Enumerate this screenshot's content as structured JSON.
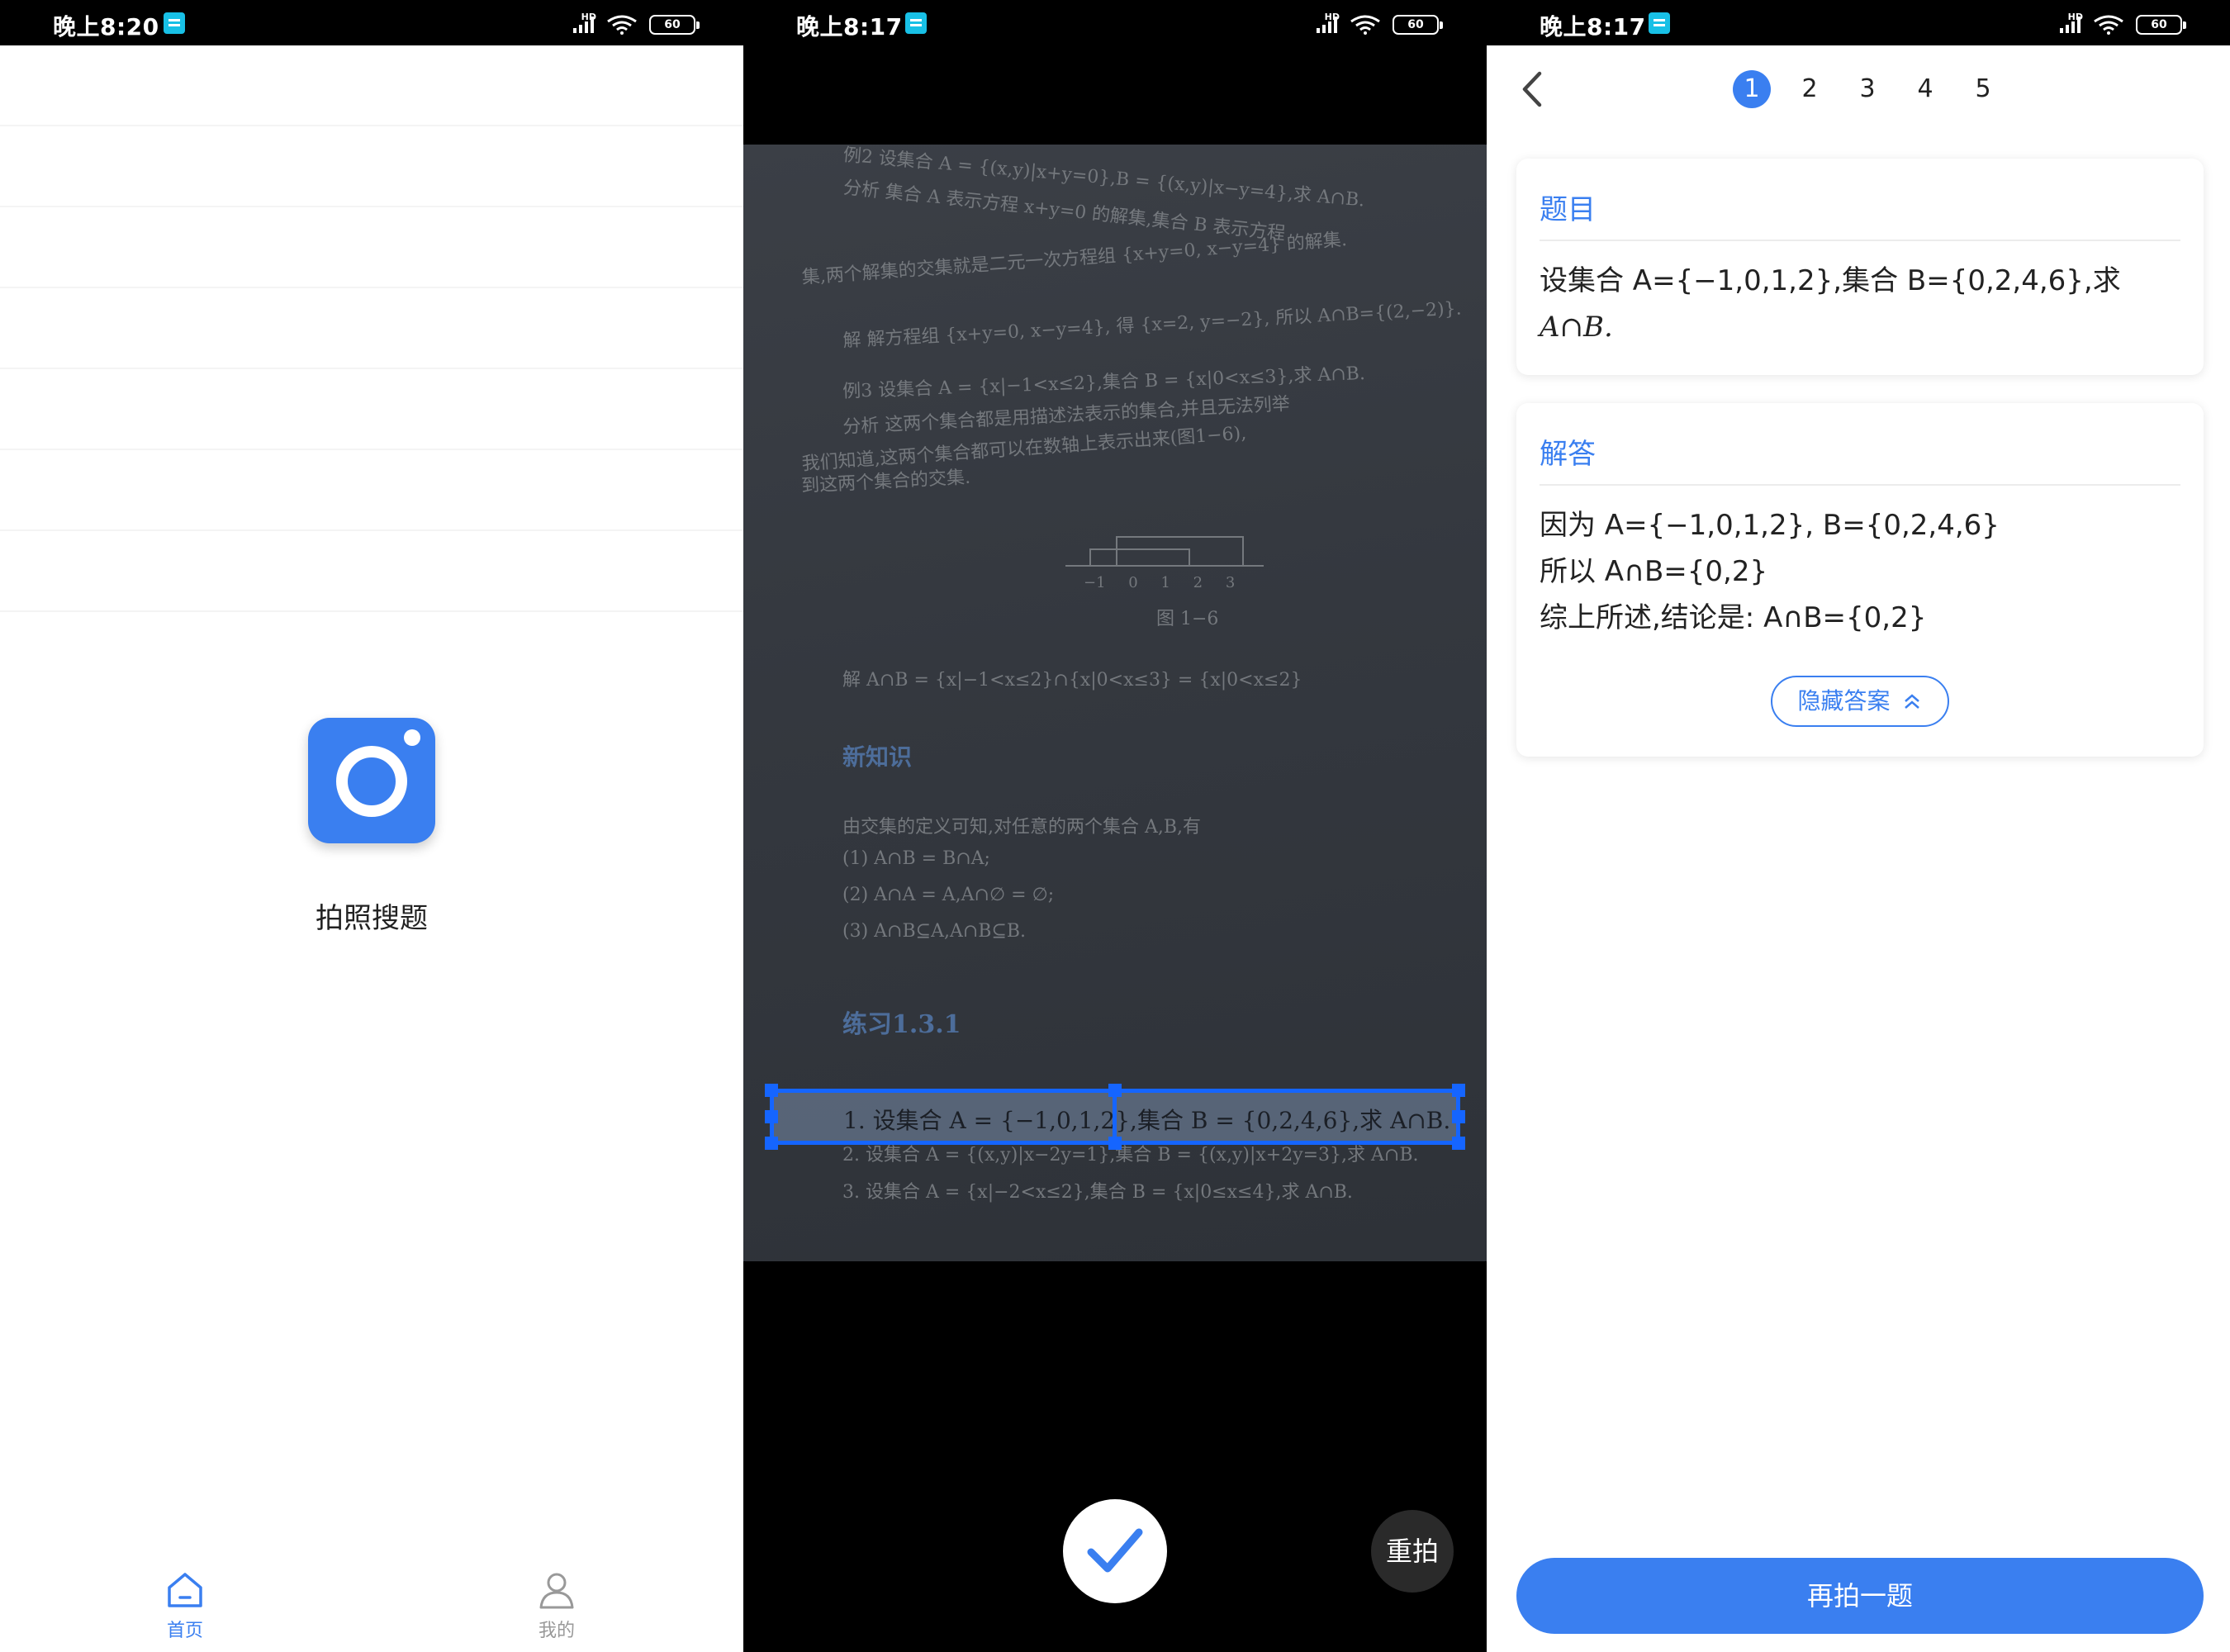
{
  "status_bars": [
    {
      "time": "晚上8:20",
      "battery": "60",
      "hd": "HD"
    },
    {
      "time": "晚上8:17",
      "battery": "60",
      "hd": "HD"
    },
    {
      "time": "晚上8:17",
      "battery": "60",
      "hd": "HD"
    }
  ],
  "home": {
    "camera_label": "拍照搜题",
    "tabs": [
      {
        "label": "首页",
        "icon": "home-icon",
        "active": true
      },
      {
        "label": "我的",
        "icon": "user-icon",
        "active": false
      }
    ]
  },
  "capture": {
    "page_lines": [
      "例2  设集合 A = {(x,y)|x+y=0},B = {(x,y)|x−y=4},求 A∩B.",
      "分析  集合 A 表示方程 x+y=0 的解集,集合 B 表示方程",
      "集,两个解集的交集就是二元一次方程组 {x+y=0, x−y=4} 的解集.",
      "解  解方程组 {x+y=0, x−y=4}, 得 {x=2, y=−2}, 所以 A∩B={(2,−2)}.",
      "例3  设集合 A = {x|−1<x≤2},集合 B = {x|0<x≤3},求 A∩B.",
      "分析  这两个集合都是用描述法表示的集合,并且无法列举",
      "我们知道,这两个集合都可以在数轴上表示出来(图1−6),",
      "到这两个集合的交集."
    ],
    "figure_caption": "图 1−6",
    "axis_ticks": [
      "−1",
      "0",
      "1",
      "2",
      "3"
    ],
    "solution_line": "解  A∩B = {x|−1<x≤2}∩{x|0<x≤3} = {x|0<x≤2}",
    "new_knowledge_heading": "新知识",
    "knowledge_lines": [
      "由交集的定义可知,对任意的两个集合 A,B,有",
      "(1) A∩B = B∩A;",
      "(2) A∩A = A,A∩∅ = ∅;",
      "(3) A∩B⊆A,A∩B⊆B."
    ],
    "exercise_heading": "练习1.3.1",
    "exercise_lines": [
      "2. 设集合 A = {(x,y)|x−2y=1},集合 B = {(x,y)|x+2y=3},求 A∩B.",
      "3. 设集合 A = {x|−2<x≤2},集合 B = {x|0≤x≤4},求 A∩B."
    ],
    "selected_line": "1. 设集合 A = {−1,0,1,2},集合 B = {0,2,4,6},求 A∩B.",
    "confirm_icon": "check-icon",
    "retake_label": "重拍"
  },
  "answer": {
    "pages": [
      "1",
      "2",
      "3",
      "4",
      "5"
    ],
    "active_page": "1",
    "question_title": "题目",
    "question_lines": [
      "设集合 A={−1,0,1,2},集合 B={0,2,4,6},求",
      "A∩B."
    ],
    "answer_title": "解答",
    "answer_lines": [
      "因为 A={−1,0,1,2}, B={0,2,4,6}",
      "所以 A∩B={0,2}",
      "综上所述,结论是: A∩B={0,2}"
    ],
    "hide_answer_label": "隐藏答案",
    "retake_again_label": "再拍一题"
  },
  "colors": {
    "accent": "#3a7ff0",
    "crop_blue": "#1565ff",
    "muted": "#999999"
  }
}
